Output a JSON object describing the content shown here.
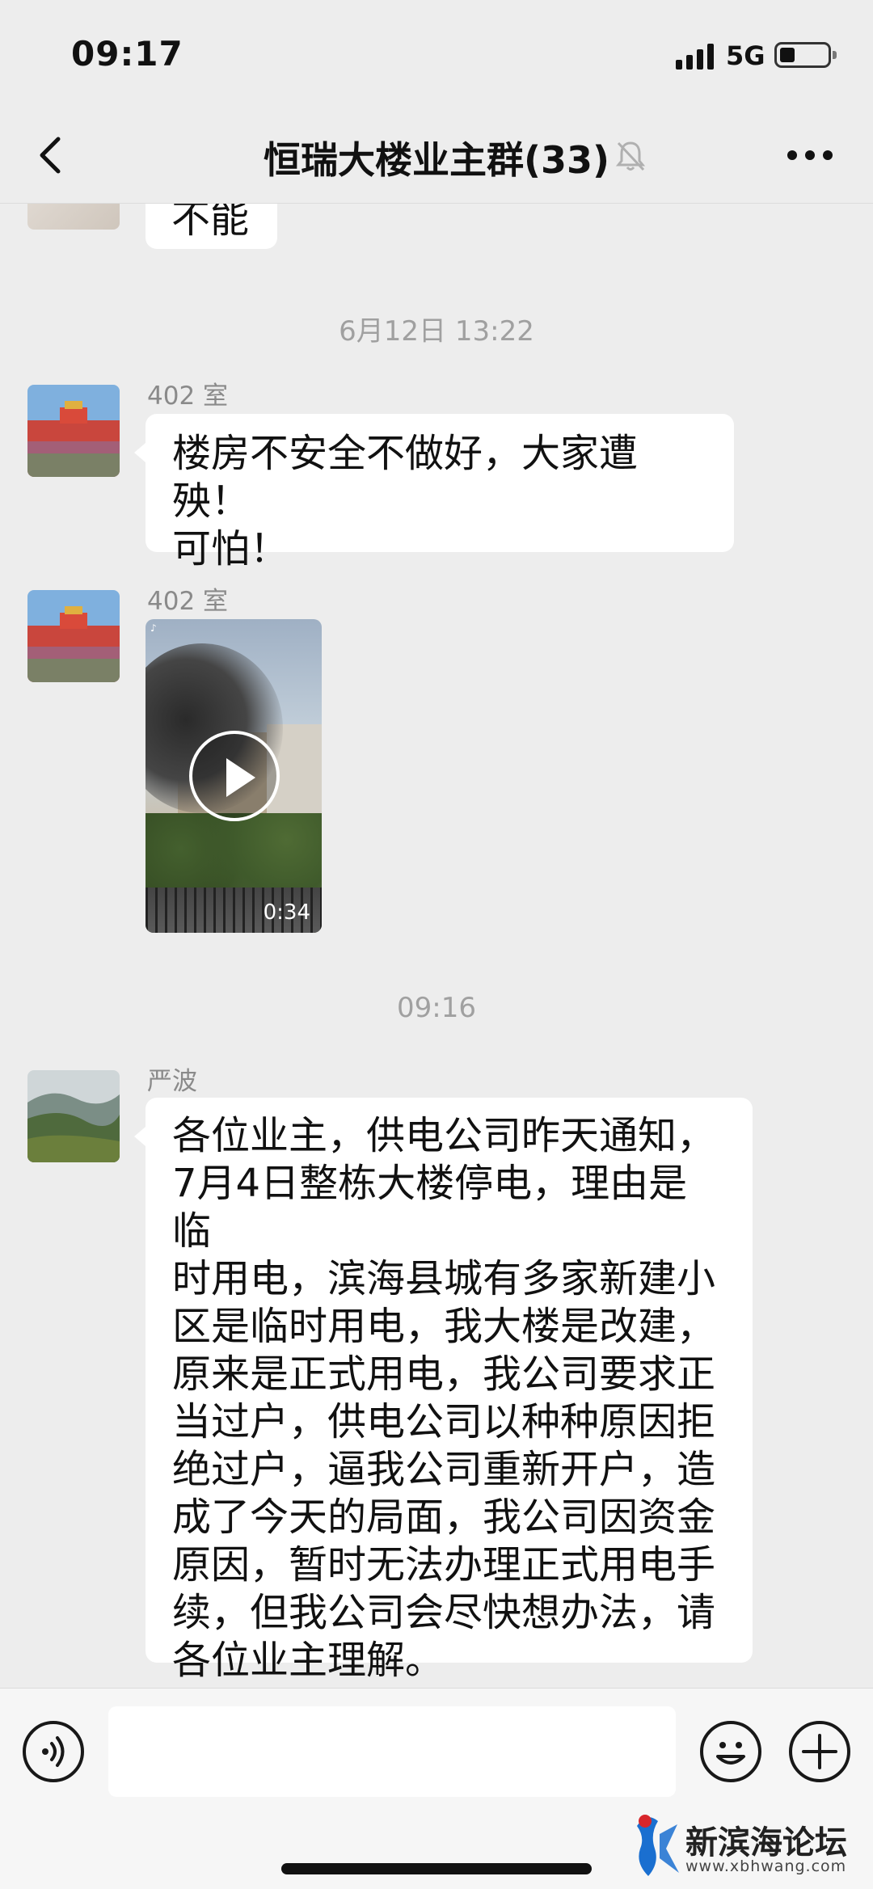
{
  "status_bar": {
    "time": "09:17",
    "network": "5G"
  },
  "nav": {
    "title": "恒瑞大楼业主群(33)"
  },
  "chat": {
    "top_partial_message": "不能",
    "timestamp_1": "6月12日 13:22",
    "messages": [
      {
        "sender": "402 室",
        "lines": [
          "楼房不安全不做好，大家遭殃！",
          "可怕！"
        ]
      },
      {
        "sender": "402 室",
        "video_duration": "0:34"
      }
    ],
    "timestamp_2": "09:16",
    "long_message": {
      "sender": "严波",
      "lines": [
        "各位业主，供电公司昨天通知，",
        "7月4日整栋大楼停电，理由是临",
        "时用电，滨海县城有多家新建小",
        "区是临时用电，我大楼是改建，",
        "原来是正式用电，我公司要求正",
        "当过户，供电公司以种种原因拒",
        "绝过户，逼我公司重新开户，造",
        "成了今天的局面，我公司因资金",
        "原因，暂时无法办理正式用电手",
        "续，但我公司会尽快想办法，请",
        "各位业主理解。"
      ]
    }
  },
  "watermark": {
    "name": "新滨海论坛",
    "url": "www.xbhwang.com"
  },
  "colors": {
    "background": "#ededed",
    "bubble": "#ffffff",
    "timestamp": "#a0a0a0"
  }
}
